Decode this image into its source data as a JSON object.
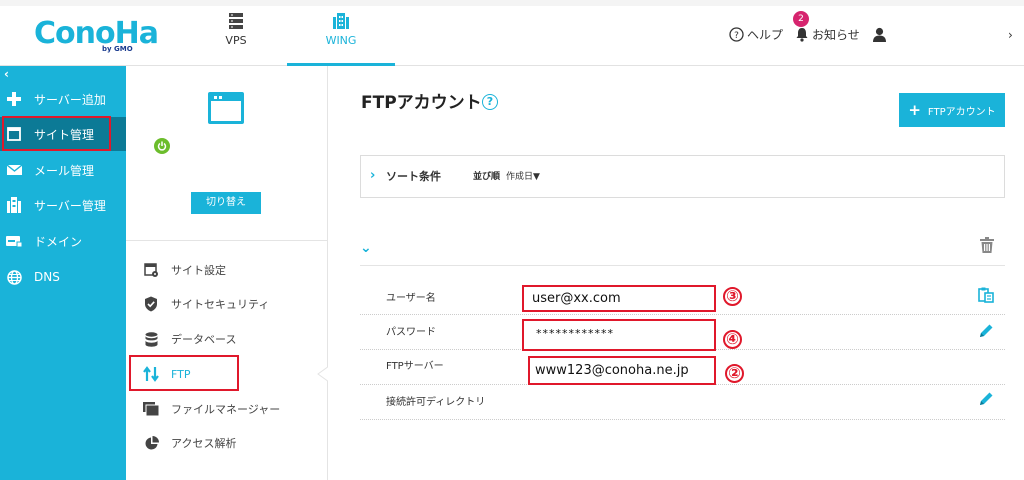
{
  "header": {
    "logo_text": "ConoHa",
    "logo_sub": "by GMO",
    "tabs": [
      {
        "label": "VPS",
        "icon": "server-stack-icon",
        "active": false
      },
      {
        "label": "WING",
        "icon": "wing-building-icon",
        "active": true
      }
    ],
    "help_label": "ヘルプ",
    "notifications_label": "お知らせ",
    "notification_count": "2",
    "user_icon": "user-icon",
    "overflow_chevron": "›"
  },
  "sidebar": {
    "collapse_glyph": "‹",
    "items": [
      {
        "label": "サーバー追加",
        "icon": "plus-icon"
      },
      {
        "label": "サイト管理",
        "icon": "site-window-icon",
        "active": true
      },
      {
        "label": "メール管理",
        "icon": "mail-icon"
      },
      {
        "label": "サーバー管理",
        "icon": "server-building-icon"
      },
      {
        "label": "ドメイン",
        "icon": "domain-tag-icon"
      },
      {
        "label": "DNS",
        "icon": "globe-icon"
      }
    ]
  },
  "site_panel": {
    "switch_label": "切り替え",
    "status": "running",
    "menu": [
      {
        "label": "サイト設定",
        "icon": "site-settings-icon"
      },
      {
        "label": "サイトセキュリティ",
        "icon": "shield-check-icon"
      },
      {
        "label": "データベース",
        "icon": "database-icon"
      },
      {
        "label": "FTP",
        "icon": "ftp-arrows-icon",
        "active": true
      },
      {
        "label": "ファイルマネージャー",
        "icon": "folder-icon"
      },
      {
        "label": "アクセス解析",
        "icon": "pie-chart-icon"
      }
    ]
  },
  "main": {
    "title": "FTPアカウント",
    "help_glyph": "?",
    "add_button_label": "FTPアカウント",
    "sort": {
      "title": "ソート条件",
      "order_label": "並び順",
      "order_value": "作成日▼"
    },
    "account": {
      "fields": [
        {
          "label": "ユーザー名",
          "value": "user@xx.com",
          "marker": "③",
          "action_icon": "copy-clipboard-icon"
        },
        {
          "label": "パスワード",
          "value": "************",
          "marker": "④",
          "action_icon": "pencil-edit-icon"
        },
        {
          "label": "FTPサーバー",
          "value": "www123@conoha.ne.jp",
          "marker": "②",
          "action_icon": ""
        },
        {
          "label": "接続許可ディレクトリ",
          "value": "",
          "marker": "",
          "action_icon": "pencil-edit-icon"
        }
      ]
    }
  },
  "colors": {
    "brand": "#1ab3d9",
    "sidebar_active": "#0c7a96",
    "annotation_red": "#e0182b",
    "badge": "#d6246e",
    "status_green": "#6cbd2c"
  }
}
